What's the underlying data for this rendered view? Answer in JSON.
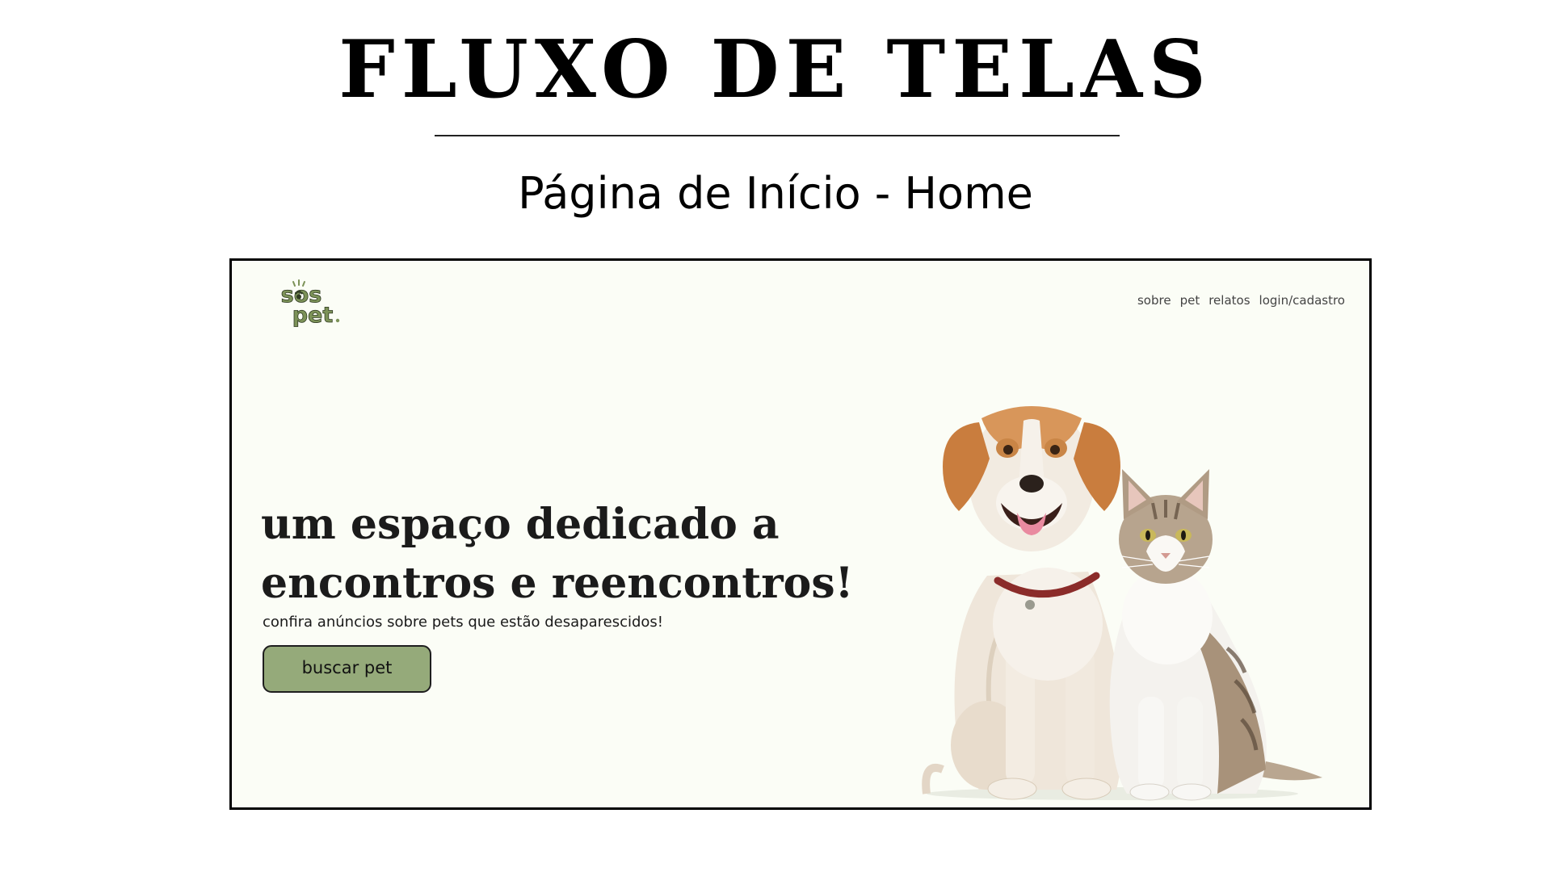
{
  "slide": {
    "title": "FLUXO DE TELAS",
    "subtitle": "Página de Início - Home"
  },
  "site": {
    "logo": {
      "line1": "sos",
      "line2": "pet",
      "brand_color": "#7c9258"
    },
    "nav": [
      {
        "label": "sobre"
      },
      {
        "label": "pet"
      },
      {
        "label": "relatos"
      },
      {
        "label": "login/cadastro"
      }
    ],
    "hero": {
      "heading": "um espaço dedicado a encontros e reencontros!",
      "subheading": "confira anúncios sobre pets que estão desaparescidos!",
      "button_label": "buscar pet",
      "button_color": "#95aa7a"
    },
    "background_color": "#fbfdf6"
  }
}
